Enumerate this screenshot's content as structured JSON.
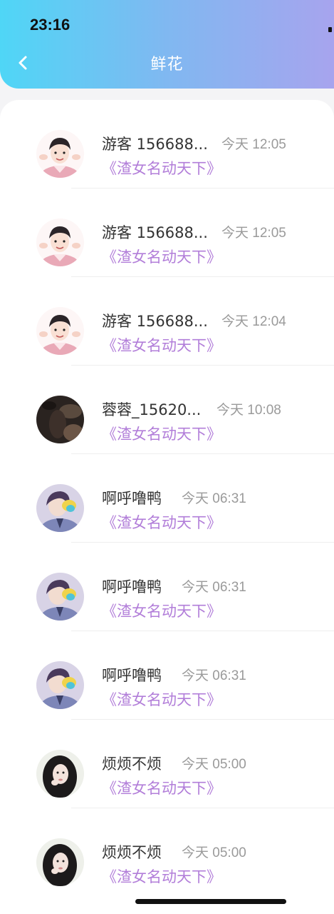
{
  "status_bar": {
    "time": "23:16"
  },
  "header": {
    "title": "鲜花",
    "back_icon": "chevron-left-icon"
  },
  "rows": [
    {
      "avatar": "boy-cartoon",
      "name": "游客 156688...",
      "time": "今天 12:05",
      "book": "《渣女名动天下》"
    },
    {
      "avatar": "boy-cartoon",
      "name": "游客 156688...",
      "time": "今天 12:05",
      "book": "《渣女名动天下》"
    },
    {
      "avatar": "boy-cartoon",
      "name": "游客 156688...",
      "time": "今天 12:04",
      "book": "《渣女名动天下》"
    },
    {
      "avatar": "dark-photo",
      "name": "蓉蓉_15620...",
      "time": "今天 10:08",
      "book": "《渣女名动天下》"
    },
    {
      "avatar": "anime-boy",
      "name": "啊呼噜鸭",
      "time": "今天 06:31",
      "book": "《渣女名动天下》"
    },
    {
      "avatar": "anime-boy",
      "name": "啊呼噜鸭",
      "time": "今天 06:31",
      "book": "《渣女名动天下》"
    },
    {
      "avatar": "anime-boy",
      "name": "啊呼噜鸭",
      "time": "今天 06:31",
      "book": "《渣女名动天下》"
    },
    {
      "avatar": "girl-photo",
      "name": "烦烦不烦",
      "time": "今天 05:00",
      "book": "《渣女名动天下》"
    },
    {
      "avatar": "girl-photo",
      "name": "烦烦不烦",
      "time": "今天 05:00",
      "book": "《渣女名动天下》"
    }
  ],
  "colors": {
    "header_gradient": [
      "#4fd6f6",
      "#a7a4ee"
    ],
    "book_title": "#b27ed9",
    "timestamp": "#9a9a9a"
  }
}
